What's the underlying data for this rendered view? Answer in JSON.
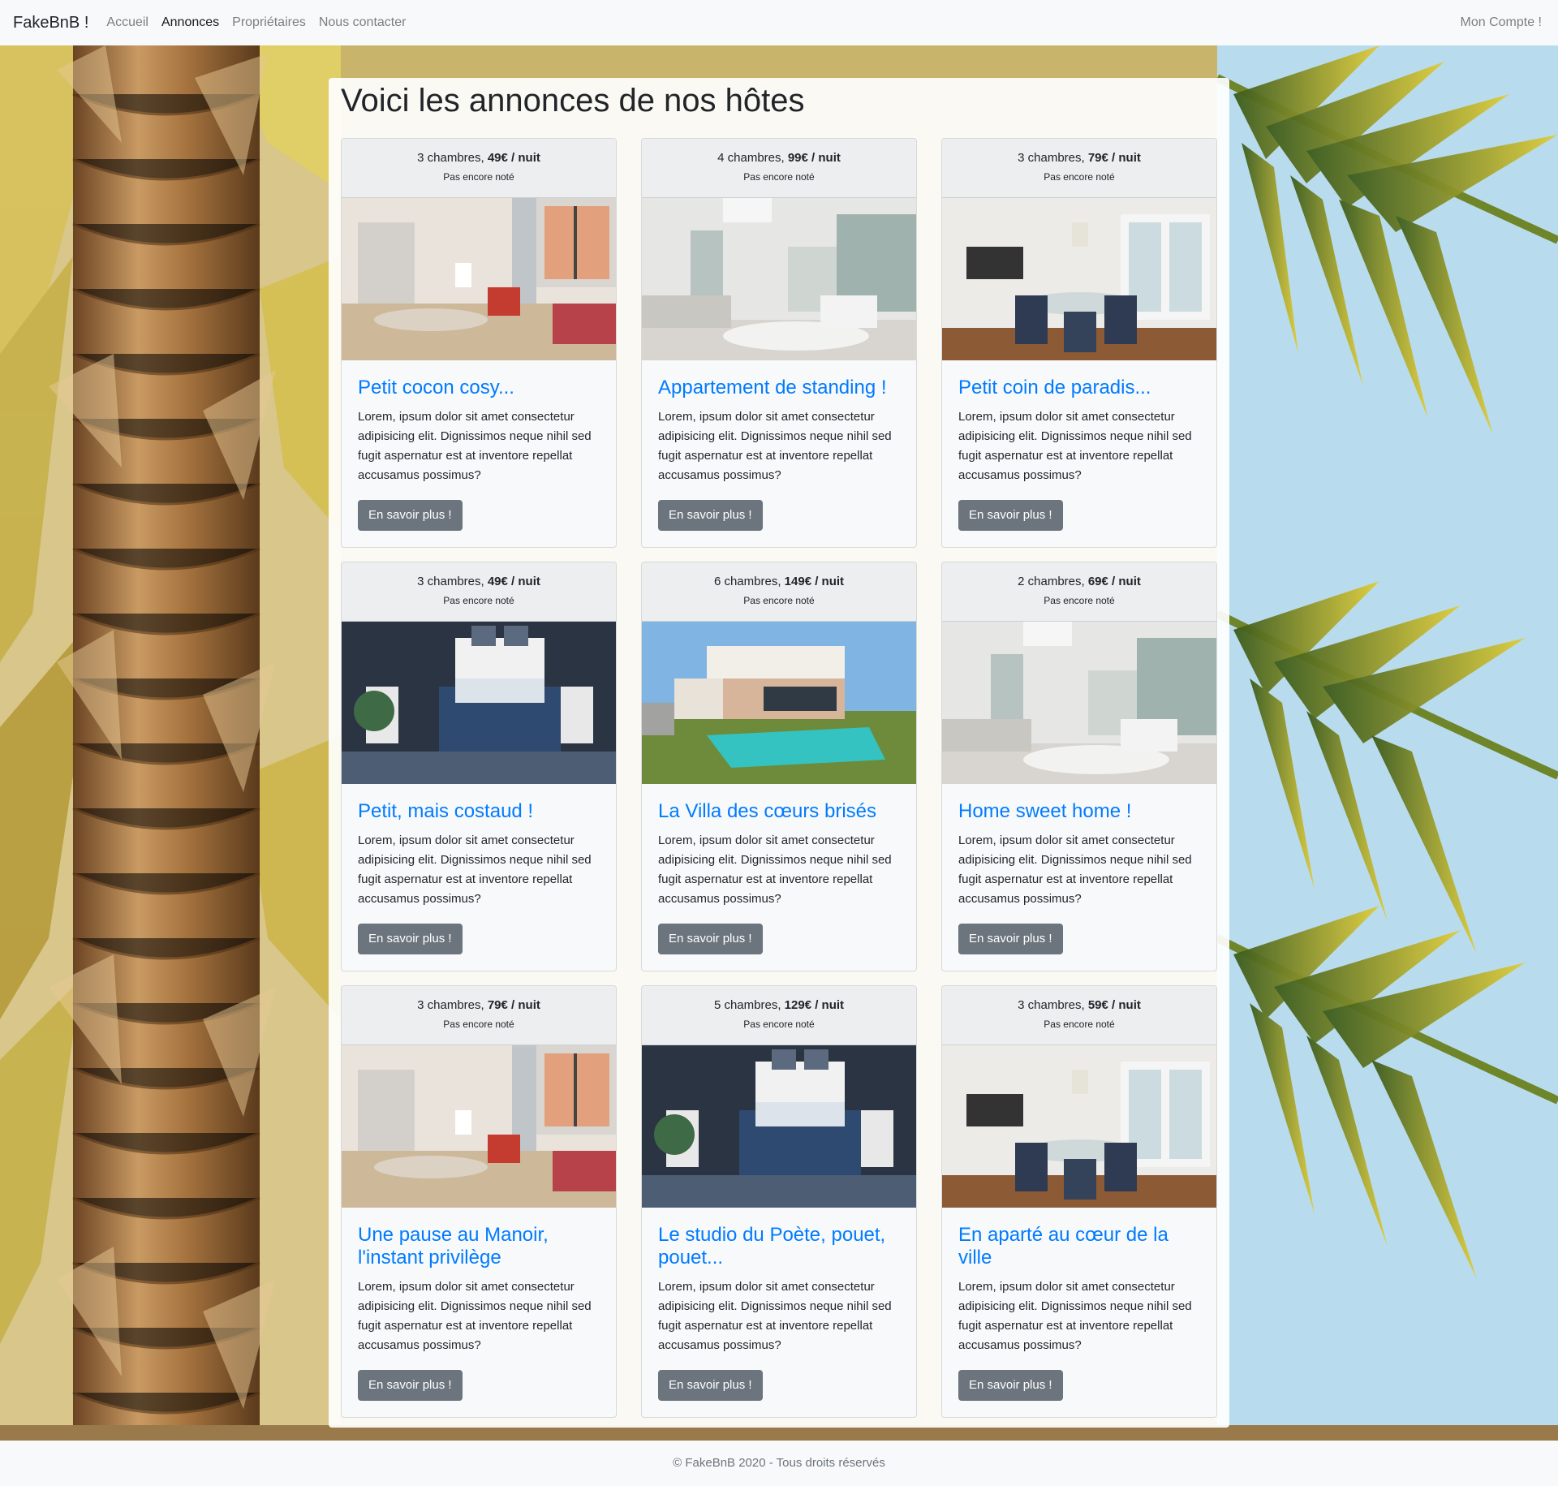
{
  "navbar": {
    "brand": "FakeBnB !",
    "links": [
      {
        "label": "Accueil",
        "active": false
      },
      {
        "label": "Annonces",
        "active": true
      },
      {
        "label": "Propriétaires",
        "active": false
      },
      {
        "label": "Nous contacter",
        "active": false
      }
    ],
    "account": "Mon Compte !"
  },
  "page": {
    "title": "Voici les annonces de nos hôtes"
  },
  "listings": [
    {
      "rooms": "3 chambres, ",
      "price": "49€ / nuit",
      "rating": "Pas encore noté",
      "image": "living-room-red-chair",
      "title": "Petit cocon cosy...",
      "text": "Lorem, ipsum dolor sit amet consectetur adipisicing elit. Dignissimos neque nihil sed fugit aspernatur est at inventore repellat accusamus possimus?",
      "button": "En savoir plus !"
    },
    {
      "rooms": "4 chambres, ",
      "price": "99€ / nuit",
      "rating": "Pas encore noté",
      "image": "bright-bedroom",
      "title": "Appartement de standing !",
      "text": "Lorem, ipsum dolor sit amet consectetur adipisicing elit. Dignissimos neque nihil sed fugit aspernatur est at inventore repellat accusamus possimus?",
      "button": "En savoir plus !"
    },
    {
      "rooms": "3 chambres, ",
      "price": "79€ / nuit",
      "rating": "Pas encore noté",
      "image": "dining-room-glass-table",
      "title": "Petit coin de paradis...",
      "text": "Lorem, ipsum dolor sit amet consectetur adipisicing elit. Dignissimos neque nihil sed fugit aspernatur est at inventore repellat accusamus possimus?",
      "button": "En savoir plus !"
    },
    {
      "rooms": "3 chambres, ",
      "price": "49€ / nuit",
      "rating": "Pas encore noté",
      "image": "dark-blue-bedroom",
      "title": "Petit, mais costaud !",
      "text": "Lorem, ipsum dolor sit amet consectetur adipisicing elit. Dignissimos neque nihil sed fugit aspernatur est at inventore repellat accusamus possimus?",
      "button": "En savoir plus !"
    },
    {
      "rooms": "6 chambres, ",
      "price": "149€ / nuit",
      "rating": "Pas encore noté",
      "image": "villa-with-pool",
      "title": "La Villa des cœurs brisés",
      "text": "Lorem, ipsum dolor sit amet consectetur adipisicing elit. Dignissimos neque nihil sed fugit aspernatur est at inventore repellat accusamus possimus?",
      "button": "En savoir plus !"
    },
    {
      "rooms": "2 chambres, ",
      "price": "69€ / nuit",
      "rating": "Pas encore noté",
      "image": "bright-bedroom",
      "title": "Home sweet home !",
      "text": "Lorem, ipsum dolor sit amet consectetur adipisicing elit. Dignissimos neque nihil sed fugit aspernatur est at inventore repellat accusamus possimus?",
      "button": "En savoir plus !"
    },
    {
      "rooms": "3 chambres, ",
      "price": "79€ / nuit",
      "rating": "Pas encore noté",
      "image": "living-room-red-chair",
      "title": "Une pause au Manoir, l'instant privilège",
      "text": "Lorem, ipsum dolor sit amet consectetur adipisicing elit. Dignissimos neque nihil sed fugit aspernatur est at inventore repellat accusamus possimus?",
      "button": "En savoir plus !"
    },
    {
      "rooms": "5 chambres, ",
      "price": "129€ / nuit",
      "rating": "Pas encore noté",
      "image": "dark-blue-bedroom",
      "title": "Le studio du Poète, pouet, pouet...",
      "text": "Lorem, ipsum dolor sit amet consectetur adipisicing elit. Dignissimos neque nihil sed fugit aspernatur est at inventore repellat accusamus possimus?",
      "button": "En savoir plus !"
    },
    {
      "rooms": "3 chambres, ",
      "price": "59€ / nuit",
      "rating": "Pas encore noté",
      "image": "dining-room-glass-table",
      "title": "En aparté au cœur de la ville",
      "text": "Lorem, ipsum dolor sit amet consectetur adipisicing elit. Dignissimos neque nihil sed fugit aspernatur est at inventore repellat accusamus possimus?",
      "button": "En savoir plus !"
    }
  ],
  "footer": {
    "text": "© FakeBnB 2020 - Tous droits réservés"
  },
  "colors": {
    "link": "#007bff",
    "button": "#6c757d",
    "navbar": "#f8f9fa"
  }
}
